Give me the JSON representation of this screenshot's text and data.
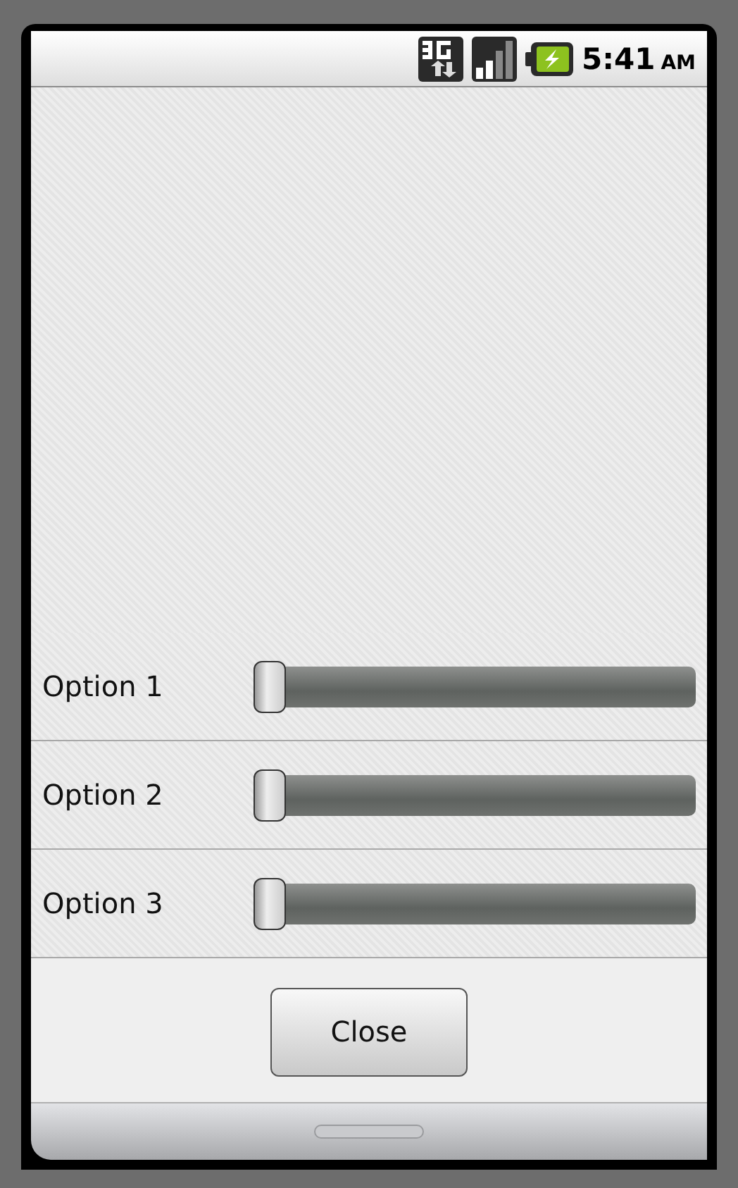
{
  "status_bar": {
    "time": "5:41",
    "meridiem": "AM"
  },
  "options": [
    {
      "label": "Option 1",
      "level": 0
    },
    {
      "label": "Option 2",
      "level": 0
    },
    {
      "label": "Option 3",
      "level": 0
    }
  ],
  "buttons": [
    "Close"
  ]
}
